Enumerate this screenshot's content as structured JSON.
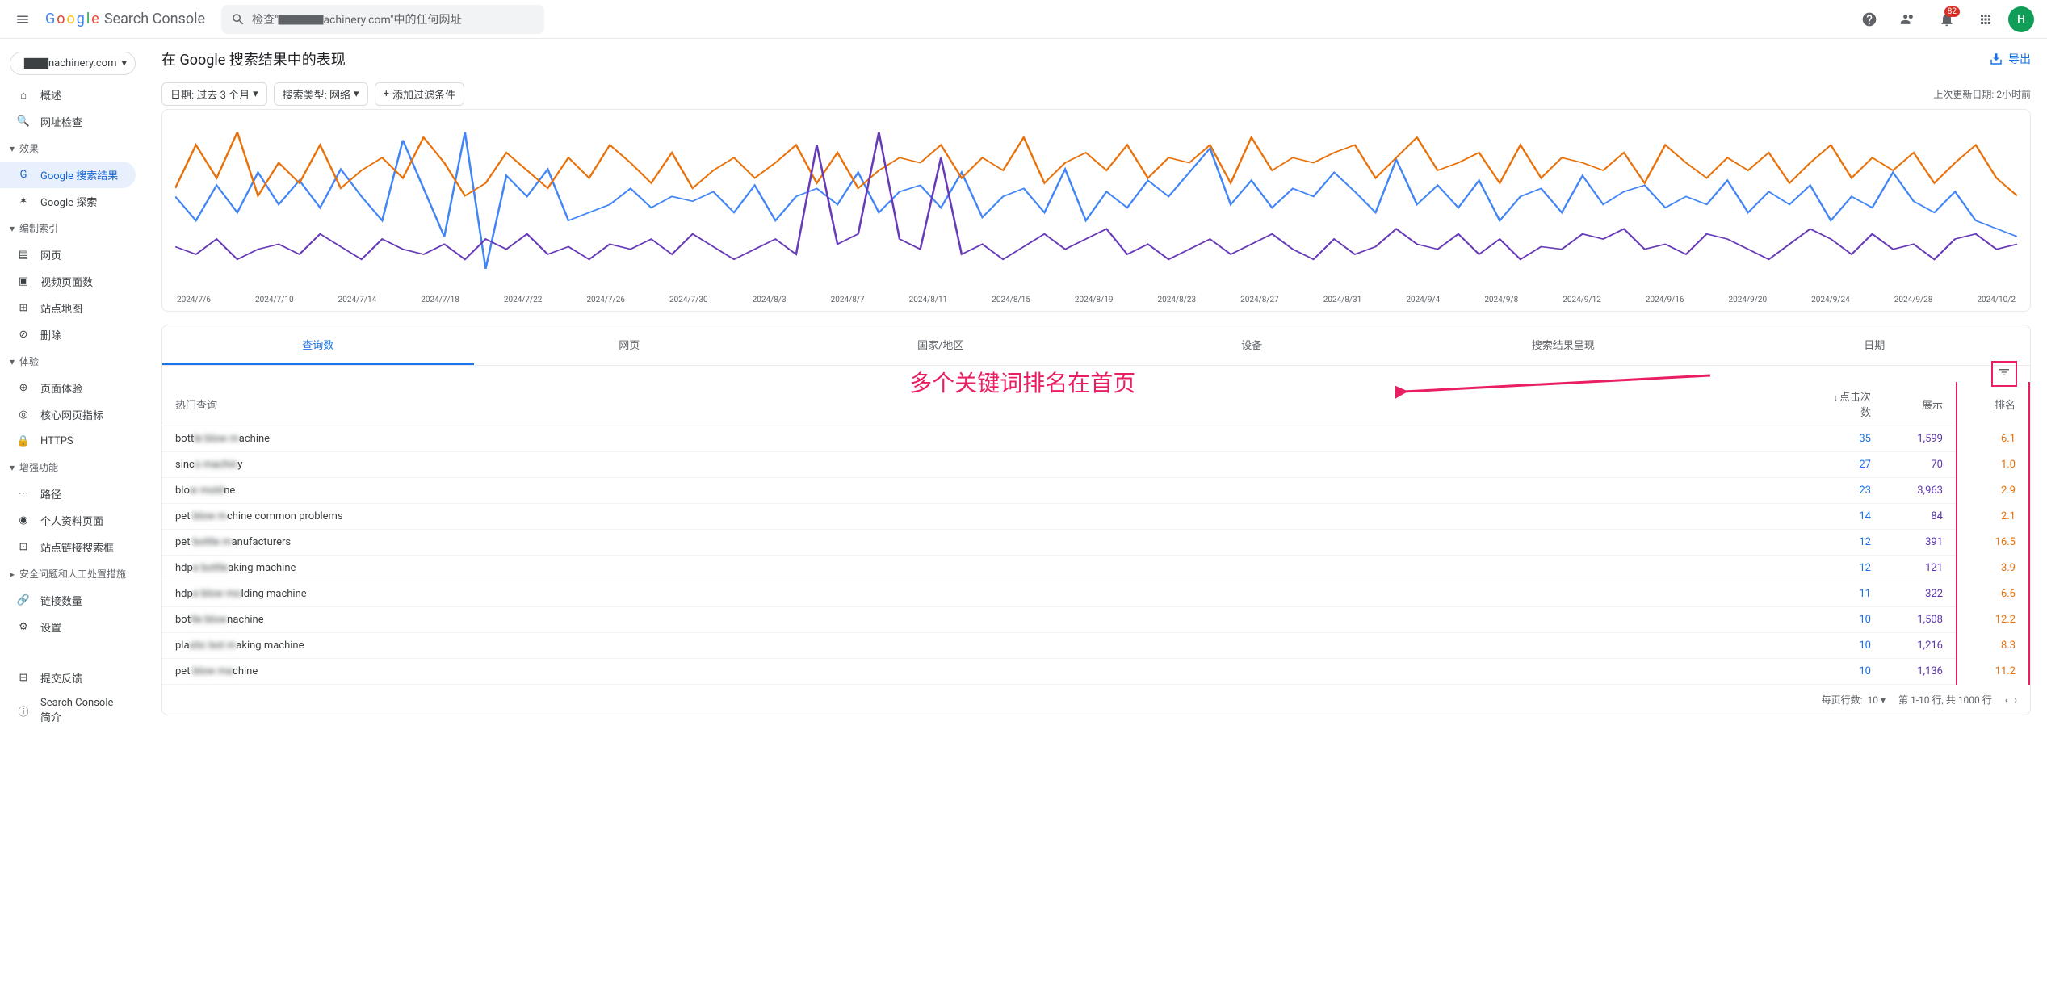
{
  "header": {
    "logo_product": "Search Console",
    "search_placeholder": "检查\"▇▇▇▇achinery.com\"中的任何网址",
    "badge_count": "82",
    "avatar_letter": "H"
  },
  "sidebar": {
    "property": "▇▇▇nachinery.com",
    "items_top": [
      {
        "label": "概述",
        "icon": "home"
      },
      {
        "label": "网址检查",
        "icon": "search"
      }
    ],
    "section_performance": "效果",
    "items_perf": [
      {
        "label": "Google 搜索结果",
        "icon": "G",
        "active": true
      },
      {
        "label": "Google 探索",
        "icon": "star"
      }
    ],
    "section_index": "编制索引",
    "items_index": [
      {
        "label": "网页",
        "icon": "page"
      },
      {
        "label": "视频页面数",
        "icon": "video"
      },
      {
        "label": "站点地图",
        "icon": "sitemap"
      },
      {
        "label": "删除",
        "icon": "remove"
      }
    ],
    "section_experience": "体验",
    "items_exp": [
      {
        "label": "页面体验",
        "icon": "plus-circle"
      },
      {
        "label": "核心网页指标",
        "icon": "vitals"
      },
      {
        "label": "HTTPS",
        "icon": "lock"
      }
    ],
    "section_enhance": "增强功能",
    "items_enhance": [
      {
        "label": "路径",
        "icon": "breadcrumb"
      },
      {
        "label": "个人资料页面",
        "icon": "profile"
      },
      {
        "label": "站点链接搜索框",
        "icon": "sitelinks"
      }
    ],
    "section_security": "安全问题和人工处置措施",
    "items_links": [
      {
        "label": "链接数量",
        "icon": "link"
      },
      {
        "label": "设置",
        "icon": "gear"
      }
    ],
    "footer": [
      {
        "label": "提交反馈",
        "icon": "feedback"
      },
      {
        "label": "Search Console 简介",
        "icon": "info"
      }
    ]
  },
  "page": {
    "title": "在 Google 搜索结果中的表现",
    "export_label": "导出",
    "filter_date": "日期: 过去 3 个月",
    "filter_type": "搜索类型: 网络",
    "filter_add": "添加过滤条件",
    "last_update": "上次更新日期: 2小时前"
  },
  "chart_data": {
    "type": "line",
    "x_labels": [
      "2024/7/6",
      "2024/7/10",
      "2024/7/14",
      "2024/7/18",
      "2024/7/22",
      "2024/7/26",
      "2024/7/30",
      "2024/8/3",
      "2024/8/7",
      "2024/8/11",
      "2024/8/15",
      "2024/8/19",
      "2024/8/23",
      "2024/8/27",
      "2024/8/31",
      "2024/9/4",
      "2024/9/8",
      "2024/9/12",
      "2024/9/16",
      "2024/9/20",
      "2024/9/24",
      "2024/9/28",
      "2024/10/2"
    ],
    "series": [
      {
        "name": "clicks",
        "color": "#4285f4",
        "values": [
          55,
          40,
          62,
          45,
          70,
          50,
          65,
          48,
          72,
          55,
          40,
          90,
          60,
          30,
          95,
          10,
          68,
          55,
          72,
          40,
          45,
          50,
          60,
          48,
          55,
          52,
          58,
          45,
          62,
          40,
          55,
          60,
          50,
          70,
          45,
          58,
          62,
          48,
          70,
          42,
          55,
          60,
          45,
          72,
          40,
          58,
          48,
          65,
          55,
          70,
          85,
          50,
          65,
          48,
          60,
          55,
          70,
          58,
          45,
          78,
          50,
          62,
          48,
          65,
          40,
          55,
          60,
          45,
          68,
          50,
          58,
          62,
          48,
          55,
          50,
          65,
          45,
          58,
          50,
          62,
          40,
          55,
          48,
          70,
          52,
          45,
          58,
          40,
          35,
          30
        ]
      },
      {
        "name": "impressions",
        "color": "#e8710a",
        "values": [
          38,
          55,
          42,
          60,
          35,
          48,
          40,
          55,
          38,
          45,
          50,
          42,
          58,
          48,
          35,
          40,
          52,
          45,
          38,
          50,
          42,
          55,
          48,
          40,
          52,
          38,
          45,
          50,
          42,
          48,
          55,
          40,
          52,
          38,
          45,
          50,
          48,
          55,
          42,
          50,
          45,
          58,
          40,
          48,
          52,
          45,
          55,
          42,
          50,
          48,
          55,
          40,
          58,
          45,
          50,
          48,
          52,
          55,
          42,
          50,
          58,
          45,
          48,
          52,
          40,
          55,
          42,
          50,
          48,
          45,
          52,
          40,
          55,
          48,
          42,
          50,
          45,
          52,
          40,
          48,
          55,
          42,
          50,
          45,
          52,
          40,
          48,
          55,
          42,
          35
        ]
      },
      {
        "name": "position",
        "color": "#673ab7",
        "values": [
          15,
          12,
          18,
          10,
          14,
          16,
          12,
          20,
          15,
          10,
          18,
          14,
          12,
          16,
          10,
          18,
          14,
          20,
          12,
          15,
          10,
          16,
          14,
          18,
          12,
          20,
          15,
          10,
          14,
          18,
          12,
          55,
          16,
          20,
          60,
          18,
          14,
          50,
          12,
          16,
          10,
          15,
          20,
          14,
          18,
          22,
          12,
          16,
          10,
          14,
          18,
          12,
          16,
          20,
          14,
          10,
          18,
          12,
          15,
          22,
          16,
          14,
          20,
          12,
          18,
          10,
          15,
          14,
          20,
          18,
          22,
          14,
          16,
          12,
          20,
          18,
          14,
          10,
          16,
          22,
          18,
          12,
          20,
          14,
          16,
          10,
          18,
          20,
          14,
          16
        ]
      }
    ]
  },
  "tabs": [
    "查询数",
    "网页",
    "国家/地区",
    "设备",
    "搜索结果呈现",
    "日期"
  ],
  "table": {
    "annotation_text": "多个关键词排名在首页",
    "col_query": "热门查询",
    "col_clicks": "点击次数",
    "col_impr": "展示",
    "col_pos": "排名",
    "rows": [
      {
        "q_prefix": "bott",
        "q_blur": "le blow m",
        "q_suffix": "achine",
        "clicks": "35",
        "impr": "1,599",
        "pos": "6.1"
      },
      {
        "q_prefix": "sinc",
        "q_blur": "o machin",
        "q_suffix": "y",
        "clicks": "27",
        "impr": "70",
        "pos": "1.0"
      },
      {
        "q_prefix": "blo",
        "q_blur": "w mold",
        "q_suffix": "ne",
        "clicks": "23",
        "impr": "3,963",
        "pos": "2.9"
      },
      {
        "q_prefix": "pet ",
        "q_blur": "blow m",
        "q_suffix": "chine common problems",
        "clicks": "14",
        "impr": "84",
        "pos": "2.1"
      },
      {
        "q_prefix": "pet ",
        "q_blur": "bottle m",
        "q_suffix": "anufacturers",
        "clicks": "12",
        "impr": "391",
        "pos": "16.5"
      },
      {
        "q_prefix": "hdp",
        "q_blur": "e bottle",
        "q_suffix": "aking machine",
        "clicks": "12",
        "impr": "121",
        "pos": "3.9"
      },
      {
        "q_prefix": "hdp",
        "q_blur": "e blow mo",
        "q_suffix": "lding machine",
        "clicks": "11",
        "impr": "322",
        "pos": "6.6"
      },
      {
        "q_prefix": "bot",
        "q_blur": "tle blow",
        "q_suffix": "nachine",
        "clicks": "10",
        "impr": "1,508",
        "pos": "12.2"
      },
      {
        "q_prefix": "pla",
        "q_blur": "stic bot m",
        "q_suffix": "aking machine",
        "clicks": "10",
        "impr": "1,216",
        "pos": "8.3"
      },
      {
        "q_prefix": "pet ",
        "q_blur": "blow ma",
        "q_suffix": "chine",
        "clicks": "10",
        "impr": "1,136",
        "pos": "11.2"
      }
    ],
    "rows_per_page_label": "每页行数:",
    "rows_per_page": "10",
    "page_info": "第 1-10 行, 共 1000 行"
  }
}
